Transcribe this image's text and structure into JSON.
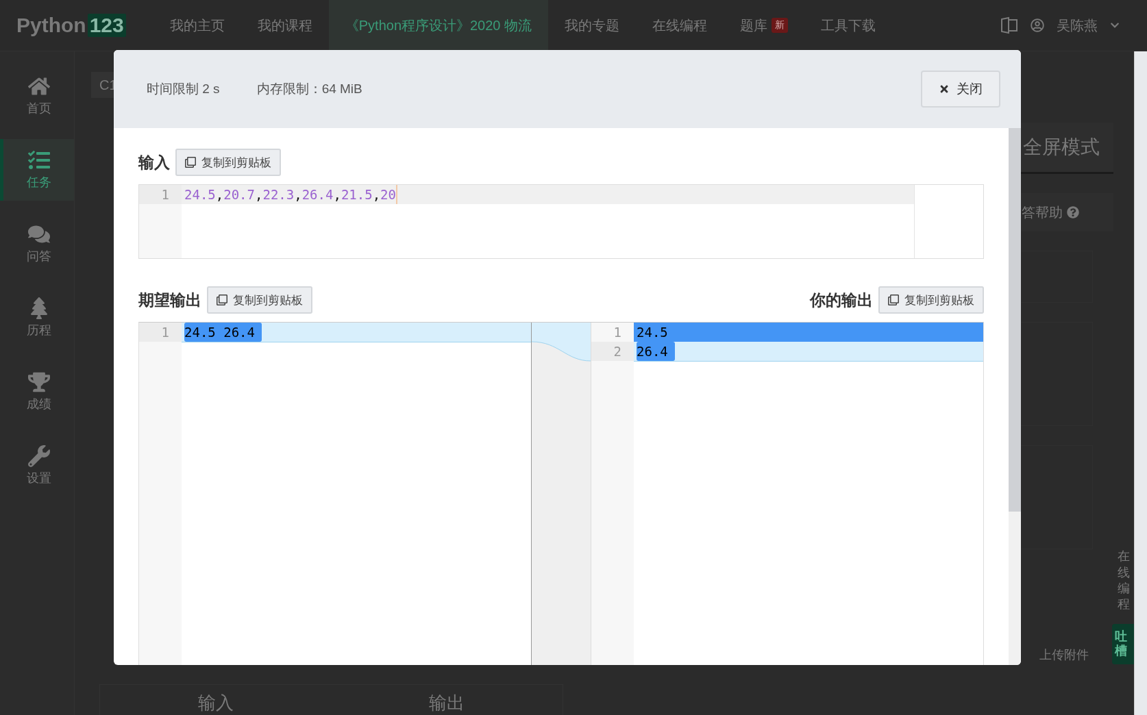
{
  "topbar": {
    "logo": {
      "text": "Python",
      "badge": "123"
    },
    "items": [
      {
        "label": "我的主页",
        "selected": false
      },
      {
        "label": "我的课程",
        "selected": false
      },
      {
        "label": "《Python程序设计》2020 物流",
        "selected": true
      },
      {
        "label": "我的专题",
        "selected": false
      },
      {
        "label": "在线编程",
        "selected": false
      },
      {
        "label": "题库",
        "selected": false,
        "badge": "新"
      },
      {
        "label": "工具下载",
        "selected": false
      }
    ],
    "user": "吴陈燕"
  },
  "sidebar": {
    "items": [
      {
        "label": "首页",
        "selected": false
      },
      {
        "label": "任务",
        "selected": true
      },
      {
        "label": "问答",
        "selected": false
      },
      {
        "label": "历程",
        "selected": false
      },
      {
        "label": "成绩",
        "selected": false
      },
      {
        "label": "设置",
        "selected": false
      }
    ]
  },
  "background": {
    "tab": "C1",
    "fullscreen": "全屏模式",
    "help": "答帮助",
    "side_tab": "在线编程",
    "feedback": "吐槽",
    "upload": "上传附件",
    "io_tabs": [
      "输入",
      "输出"
    ]
  },
  "modal": {
    "time_limit": "时间限制 2 s",
    "memory_limit": "内存限制：64 MiB",
    "close": "关闭",
    "input": {
      "label": "输入",
      "copy": "复制到剪贴板",
      "lines": [
        {
          "number": "1",
          "tokens": [
            {
              "kind": "number",
              "text": "24.5"
            },
            {
              "kind": "punct",
              "text": ","
            },
            {
              "kind": "number",
              "text": "20.7"
            },
            {
              "kind": "punct",
              "text": ","
            },
            {
              "kind": "number",
              "text": "22.3"
            },
            {
              "kind": "punct",
              "text": ","
            },
            {
              "kind": "number",
              "text": "26.4"
            },
            {
              "kind": "punct",
              "text": ","
            },
            {
              "kind": "number",
              "text": "21.5"
            },
            {
              "kind": "punct",
              "text": ","
            },
            {
              "kind": "number",
              "text": "20"
            }
          ]
        }
      ]
    },
    "expected": {
      "label": "期望输出",
      "copy": "复制到剪贴板",
      "lines": [
        {
          "number": "1",
          "text": "24.5 26.4",
          "kind": "text"
        }
      ]
    },
    "actual": {
      "label": "你的输出",
      "copy": "复制到剪贴板",
      "lines": [
        {
          "number": "1",
          "text": "24.5",
          "kind": "line"
        },
        {
          "number": "2",
          "text": "26.4",
          "kind": "text"
        }
      ]
    }
  }
}
